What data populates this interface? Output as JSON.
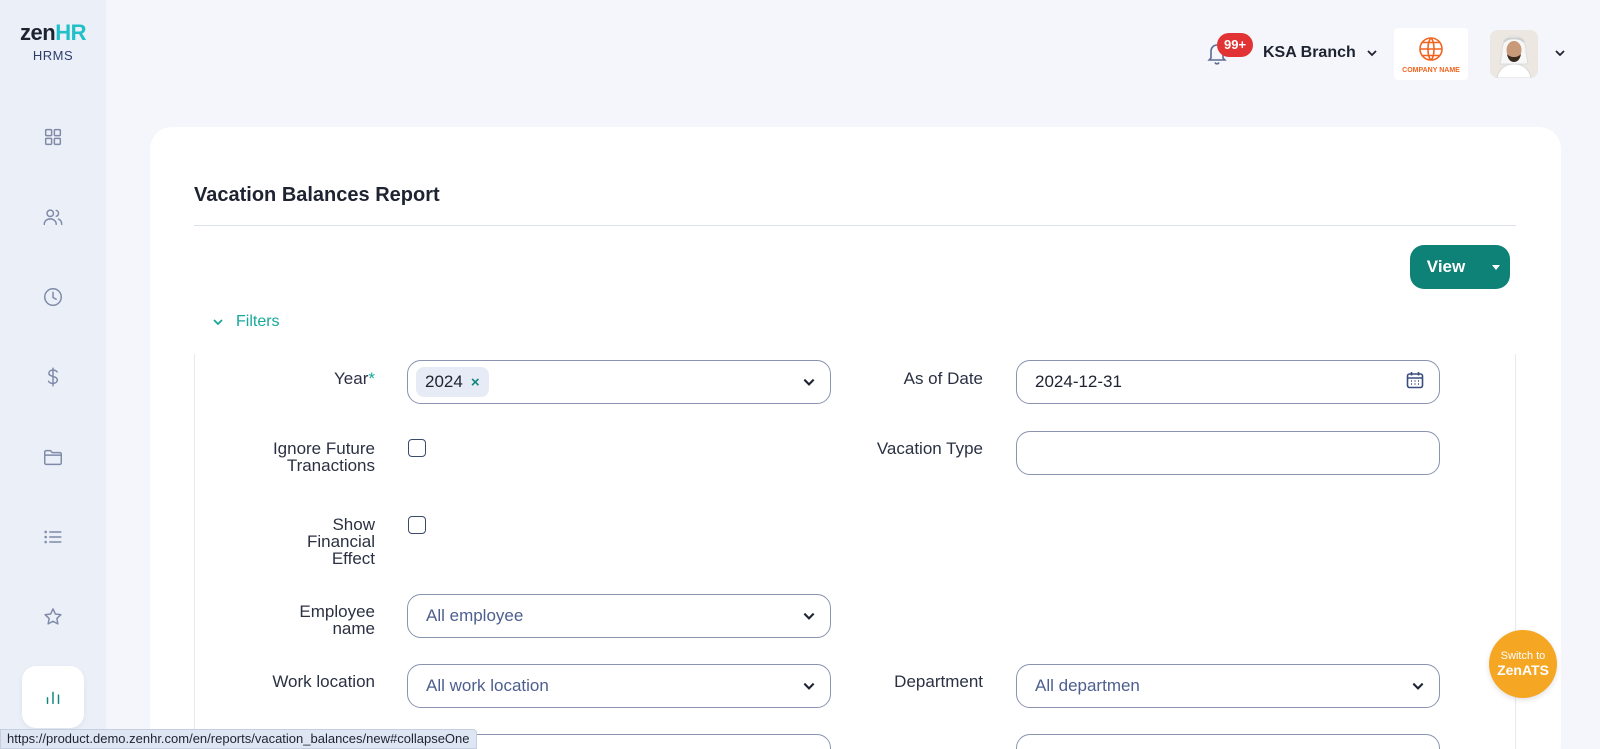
{
  "app": {
    "logo_primary": "zen",
    "logo_accent": "HR",
    "logo_sub": "HRMS"
  },
  "sidebar": {
    "items": [
      {
        "icon": "dashboard-icon",
        "active": false
      },
      {
        "icon": "people-icon",
        "active": false
      },
      {
        "icon": "clock-icon",
        "active": false
      },
      {
        "icon": "dollar-icon",
        "active": false
      },
      {
        "icon": "folder-icon",
        "active": false
      },
      {
        "icon": "list-icon",
        "active": false
      },
      {
        "icon": "star-icon",
        "active": false
      },
      {
        "icon": "bar-chart-icon",
        "active": true
      }
    ]
  },
  "header": {
    "notification_count": "99+",
    "branch": "KSA Branch",
    "company_logo_text": "COMPANY NAME"
  },
  "report": {
    "title": "Vacation Balances Report",
    "view_label": "View",
    "filters_label": "Filters"
  },
  "filters": {
    "year_label": "Year",
    "year_required": "*",
    "year_value": "2024",
    "as_of_date_label": "As of Date",
    "as_of_date_value": "2024-12-31",
    "ignore_future_line1": "Ignore Future",
    "ignore_future_line2": "Tranactions",
    "vacation_type_label": "Vacation Type",
    "vacation_type_value": "",
    "show_financial_line1": "Show",
    "show_financial_line2": "Financial",
    "show_financial_line3": "Effect",
    "employee_label_line1": "Employee",
    "employee_label_line2": "name",
    "employee_placeholder": "All employee",
    "work_location_label": "Work location",
    "work_location_placeholder": "All work location",
    "department_label": "Department",
    "department_placeholder": "All departmen"
  },
  "fab": {
    "line1": "Switch to",
    "line2": "ZenATS"
  },
  "status_url": "https://product.demo.zenhr.com/en/reports/vacation_balances/new#collapseOne",
  "colors": {
    "accent": "#0f8277",
    "teal_text": "#17a89b",
    "badge": "#e13333",
    "fab": "#f5a623"
  }
}
